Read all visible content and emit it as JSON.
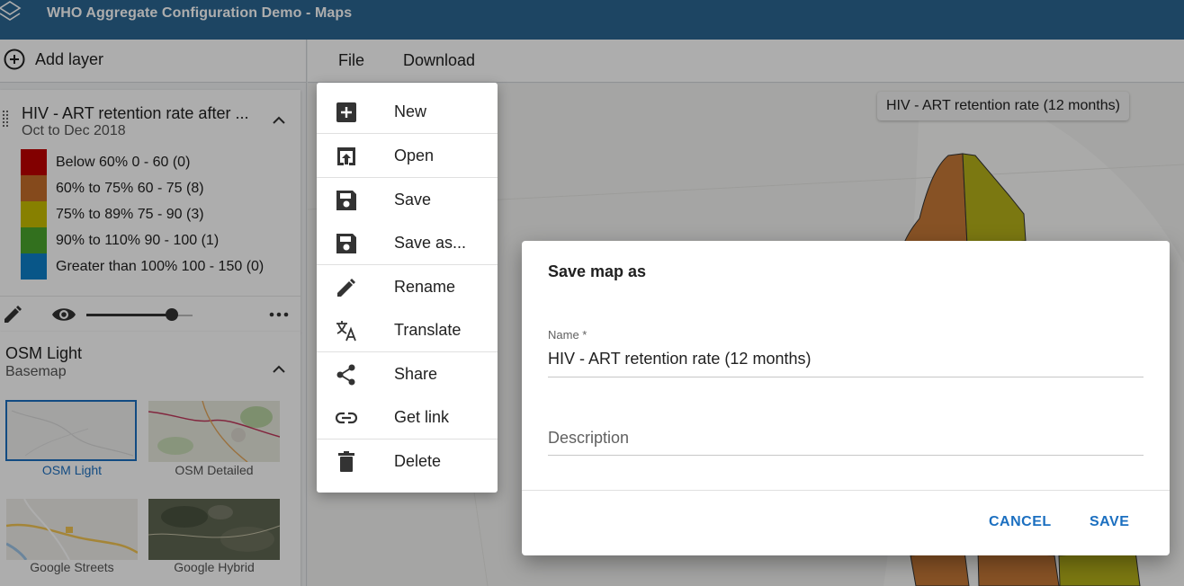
{
  "header": {
    "title": "WHO Aggregate Configuration Demo - Maps",
    "logo_icon": "layers-logo-icon"
  },
  "toolbar": {
    "add_layer_label": "Add layer"
  },
  "menubar": {
    "file_label": "File",
    "download_label": "Download"
  },
  "layer": {
    "title": "HIV - ART retention rate after ...",
    "period": "Oct to Dec 2018",
    "legend": [
      {
        "label": "Below 60% 0 - 60 (0)",
        "color": "#c00000"
      },
      {
        "label": "60% to 75% 60 - 75 (8)",
        "color": "#c56e2a"
      },
      {
        "label": "75% to 89% 75 - 90 (3)",
        "color": "#c8bd00"
      },
      {
        "label": "90% to 110% 90 - 100 (1)",
        "color": "#4aa62d"
      },
      {
        "label": "Greater than 100% 100 - 150 (0)",
        "color": "#0c7fc9"
      }
    ],
    "opacity_fraction": 0.8
  },
  "basemap": {
    "title": "OSM Light",
    "subtitle": "Basemap",
    "options": [
      {
        "label": "OSM Light",
        "selected": true
      },
      {
        "label": "OSM Detailed",
        "selected": false
      },
      {
        "label": "Google Streets",
        "selected": false
      },
      {
        "label": "Google Hybrid",
        "selected": false
      }
    ]
  },
  "map": {
    "title_chip": "HIV - ART retention rate (12 months)"
  },
  "file_menu": {
    "items": [
      {
        "label": "New",
        "icon": "add-box-icon"
      },
      {
        "label": "Open",
        "icon": "open-in-browser-icon"
      },
      {
        "label": "Save",
        "icon": "save-icon"
      },
      {
        "label": "Save as...",
        "icon": "save-as-icon"
      },
      {
        "label": "Rename",
        "icon": "pencil-icon"
      },
      {
        "label": "Translate",
        "icon": "translate-icon"
      },
      {
        "label": "Share",
        "icon": "share-icon"
      },
      {
        "label": "Get link",
        "icon": "link-icon"
      },
      {
        "label": "Delete",
        "icon": "trash-icon"
      }
    ]
  },
  "dialog": {
    "title": "Save map as",
    "name_label": "Name *",
    "name_value": "HIV - ART retention rate (12 months)",
    "description_placeholder": "Description",
    "cancel_label": "CANCEL",
    "save_label": "SAVE"
  },
  "colors": {
    "header_bg": "#2c6693",
    "primary": "#1b6fc0"
  }
}
